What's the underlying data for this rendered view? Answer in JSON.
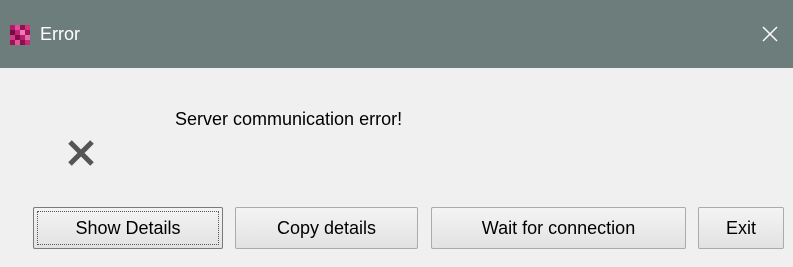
{
  "window": {
    "title": "Error",
    "title_bar_color": "#6c7d7c",
    "app_icon": "app-logo-icon",
    "close_icon": "close-icon"
  },
  "dialog": {
    "message": "Server communication error!",
    "status_icon": "error-x-icon"
  },
  "buttons": {
    "show_details": "Show Details",
    "copy_details": "Copy details",
    "wait_for_connection": "Wait for connection",
    "exit": "Exit"
  }
}
